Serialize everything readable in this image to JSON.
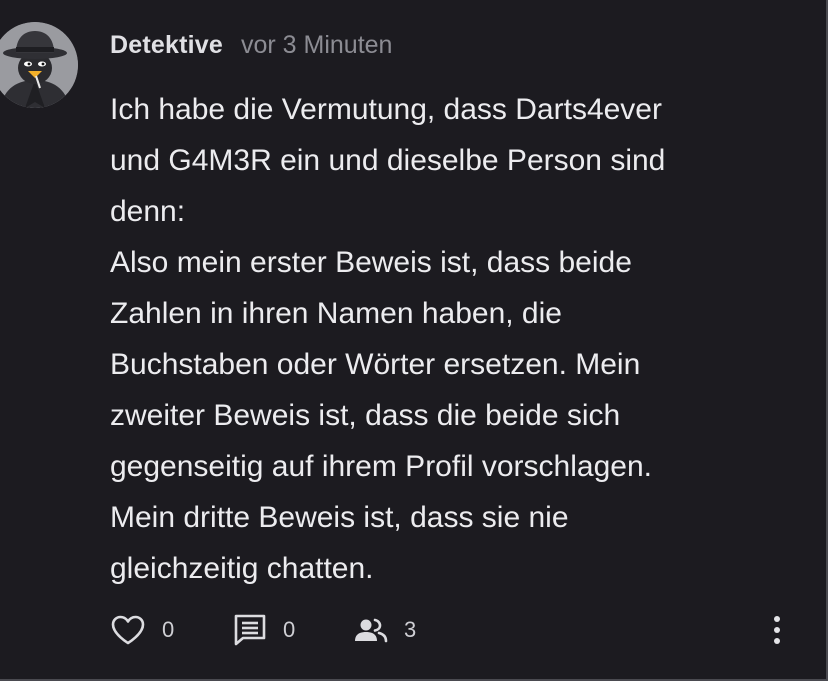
{
  "post": {
    "author": "Detektive",
    "timestamp": "vor 3 Minuten",
    "avatar_icon": "spy-detective-avatar",
    "lines": [
      "Ich habe die Vermutung, dass Darts4ever",
      "und G4M3R ein und dieselbe Person sind",
      "denn:",
      "Also mein erster Beweis ist, dass beide",
      "Zahlen in ihren Namen haben, die",
      "Buchstaben oder Wörter ersetzen. Mein",
      "zweiter Beweis ist, dass die beide sich",
      "gegenseitig auf ihrem Profil vorschlagen.",
      "Mein dritte Beweis ist, dass sie nie",
      "gleichzeitig chatten."
    ]
  },
  "actions": {
    "likes": "0",
    "comments": "0",
    "participants": "3",
    "like_icon": "heart-icon",
    "comment_icon": "comment-icon",
    "participants_icon": "people-icon",
    "more_icon": "more-vertical-icon"
  },
  "colors": {
    "background": "#1c1b20",
    "text": "#ececef",
    "muted": "#8c8c93",
    "avatar_bg": "#9a9ba0"
  }
}
